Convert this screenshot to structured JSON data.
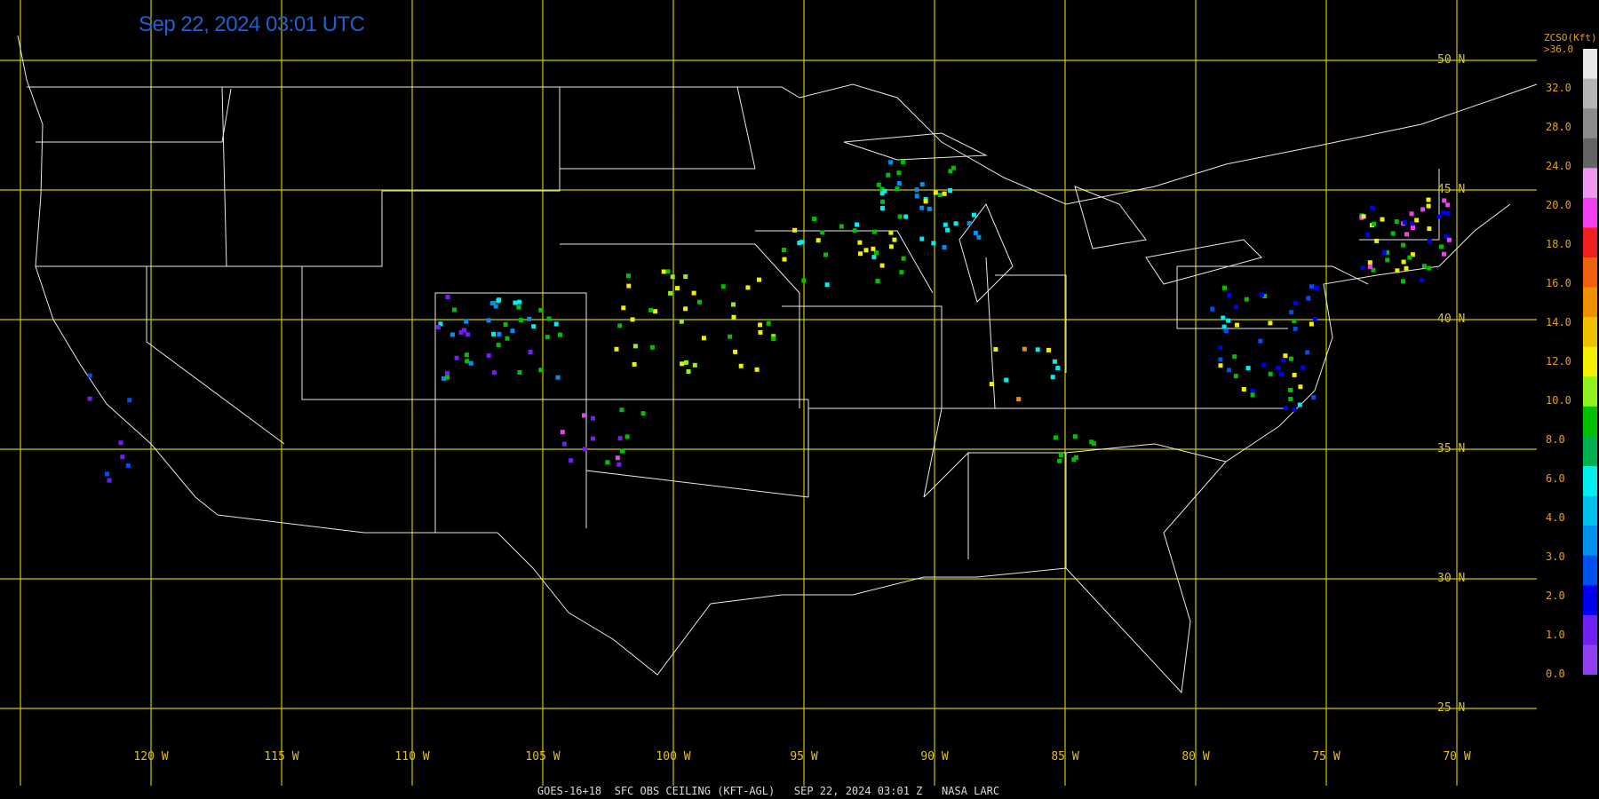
{
  "header": {
    "timestamp": "Sep 22, 2024 03:01 UTC"
  },
  "footer": {
    "caption": "GOES-16+18  SFC OBS CEILING (KFT-AGL)   SEP 22, 2024 03:01 Z   NASA LARC"
  },
  "grid": {
    "latitudes": [
      "50 N",
      "45 N",
      "40 N",
      "35 N",
      "30 N",
      "25 N"
    ],
    "longitudes": [
      "120 W",
      "115 W",
      "110 W",
      "105 W",
      "100 W",
      "95 W",
      "90 W",
      "85 W",
      "80 W",
      "75 W",
      "70 W"
    ]
  },
  "legend": {
    "title_line1": "ZCSO(Kft)",
    "title_line2": ">36.0",
    "labels": [
      "32.0",
      "28.0",
      "24.0",
      "20.0",
      "18.0",
      "16.0",
      "14.0",
      "12.0",
      "10.0",
      "8.0",
      "6.0",
      "4.0",
      "3.0",
      "2.0",
      "1.0",
      "0.0"
    ],
    "colors": [
      "#e8e8e8",
      "#b4b4b4",
      "#8c8c8c",
      "#646464",
      "#f098f0",
      "#f040f0",
      "#f02020",
      "#f06010",
      "#f09000",
      "#f0c000",
      "#f0f000",
      "#90f020",
      "#00c000",
      "#00b050",
      "#00f0f0",
      "#00c0f0",
      "#0090f0",
      "#0050f0",
      "#0000f0",
      "#7020f0",
      "#9040f0"
    ]
  },
  "colors": {
    "grid": "#c8c800",
    "borders": "#e8e8e8",
    "background": "#000000",
    "title": "#1f5fd0"
  }
}
